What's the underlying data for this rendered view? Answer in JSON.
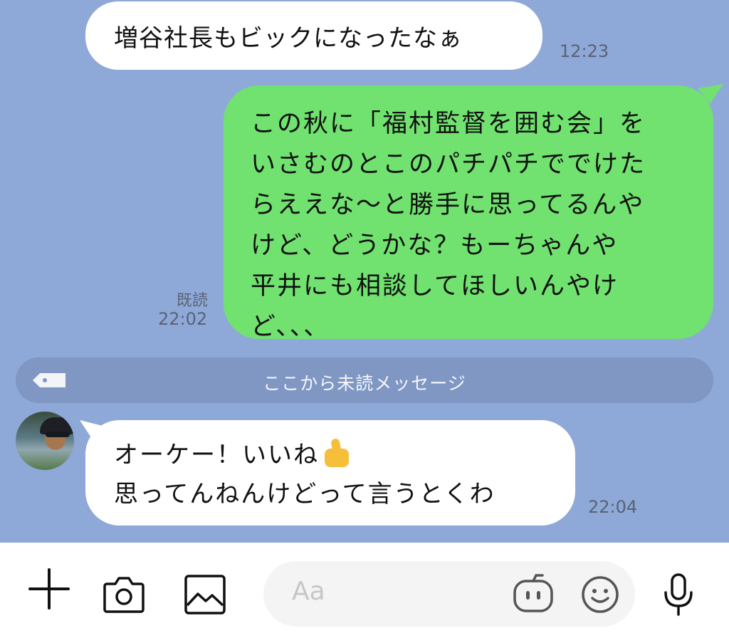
{
  "chat": {
    "messages": [
      {
        "direction": "incoming",
        "text": "増谷社長もビックになったなぁ",
        "time": "12:23"
      },
      {
        "direction": "outgoing",
        "lines": [
          "この秋に「福村監督を囲む会」を",
          "いさむのとこのパチパチででけた",
          "らええな〜と勝手に思ってるんや",
          "けど、どうかな？もーちゃんや",
          "平井にも相談してほしいんやけ",
          "ど、、、"
        ],
        "read_status": "既読",
        "time": "22:02"
      },
      {
        "direction": "incoming",
        "lines": [
          "オーケー！いいね",
          "思ってんねんけどって言うとくわ"
        ],
        "emoji": "thumbs-up",
        "time": "22:04"
      }
    ],
    "unread_divider": "ここから未読メッセージ"
  },
  "input_bar": {
    "placeholder": "Aa",
    "icons": [
      "plus-icon",
      "camera-icon",
      "image-icon",
      "bot-icon",
      "emoji-icon",
      "mic-icon"
    ]
  },
  "colors": {
    "chat_background": "#8ea9d8",
    "outgoing_bubble": "#71e270",
    "incoming_bubble": "#ffffff",
    "divider": "#8097c4"
  }
}
